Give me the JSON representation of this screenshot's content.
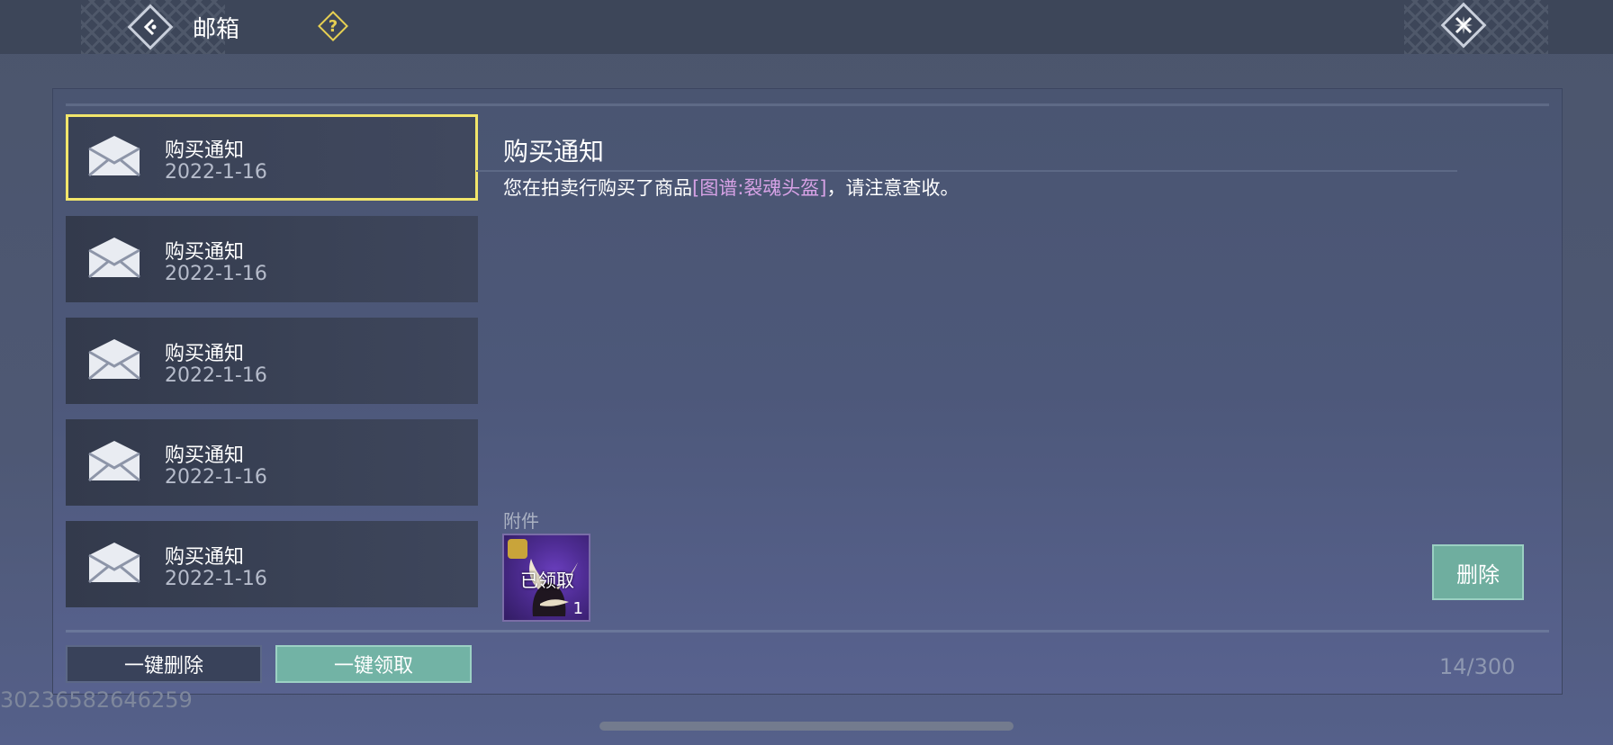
{
  "header": {
    "title": "邮箱",
    "help_label": "?"
  },
  "mail_list": {
    "items": [
      {
        "title": "购买通知",
        "date": "2022-1-16",
        "selected": true
      },
      {
        "title": "购买通知",
        "date": "2022-1-16"
      },
      {
        "title": "购买通知",
        "date": "2022-1-16"
      },
      {
        "title": "购买通知",
        "date": "2022-1-16"
      },
      {
        "title": "购买通知",
        "date": "2022-1-16"
      }
    ]
  },
  "detail": {
    "title": "购买通知",
    "body_prefix": "您在拍卖行购买了商品",
    "item_name": "[图谱:裂魂头盔]",
    "body_suffix": "，请注意查收。",
    "attachment_label": "附件",
    "attachment": {
      "status": "已领取",
      "quantity": "1"
    },
    "delete_label": "删除"
  },
  "footer": {
    "bulk_delete_label": "一键删除",
    "bulk_claim_label": "一键领取",
    "counter": "14/300"
  },
  "uid": "30236582646259",
  "colors": {
    "accent_selected": "#f2e66b",
    "claim_button": "#72b3a5",
    "item_link": "#d7a2e6",
    "help_icon": "#e6cf52"
  }
}
